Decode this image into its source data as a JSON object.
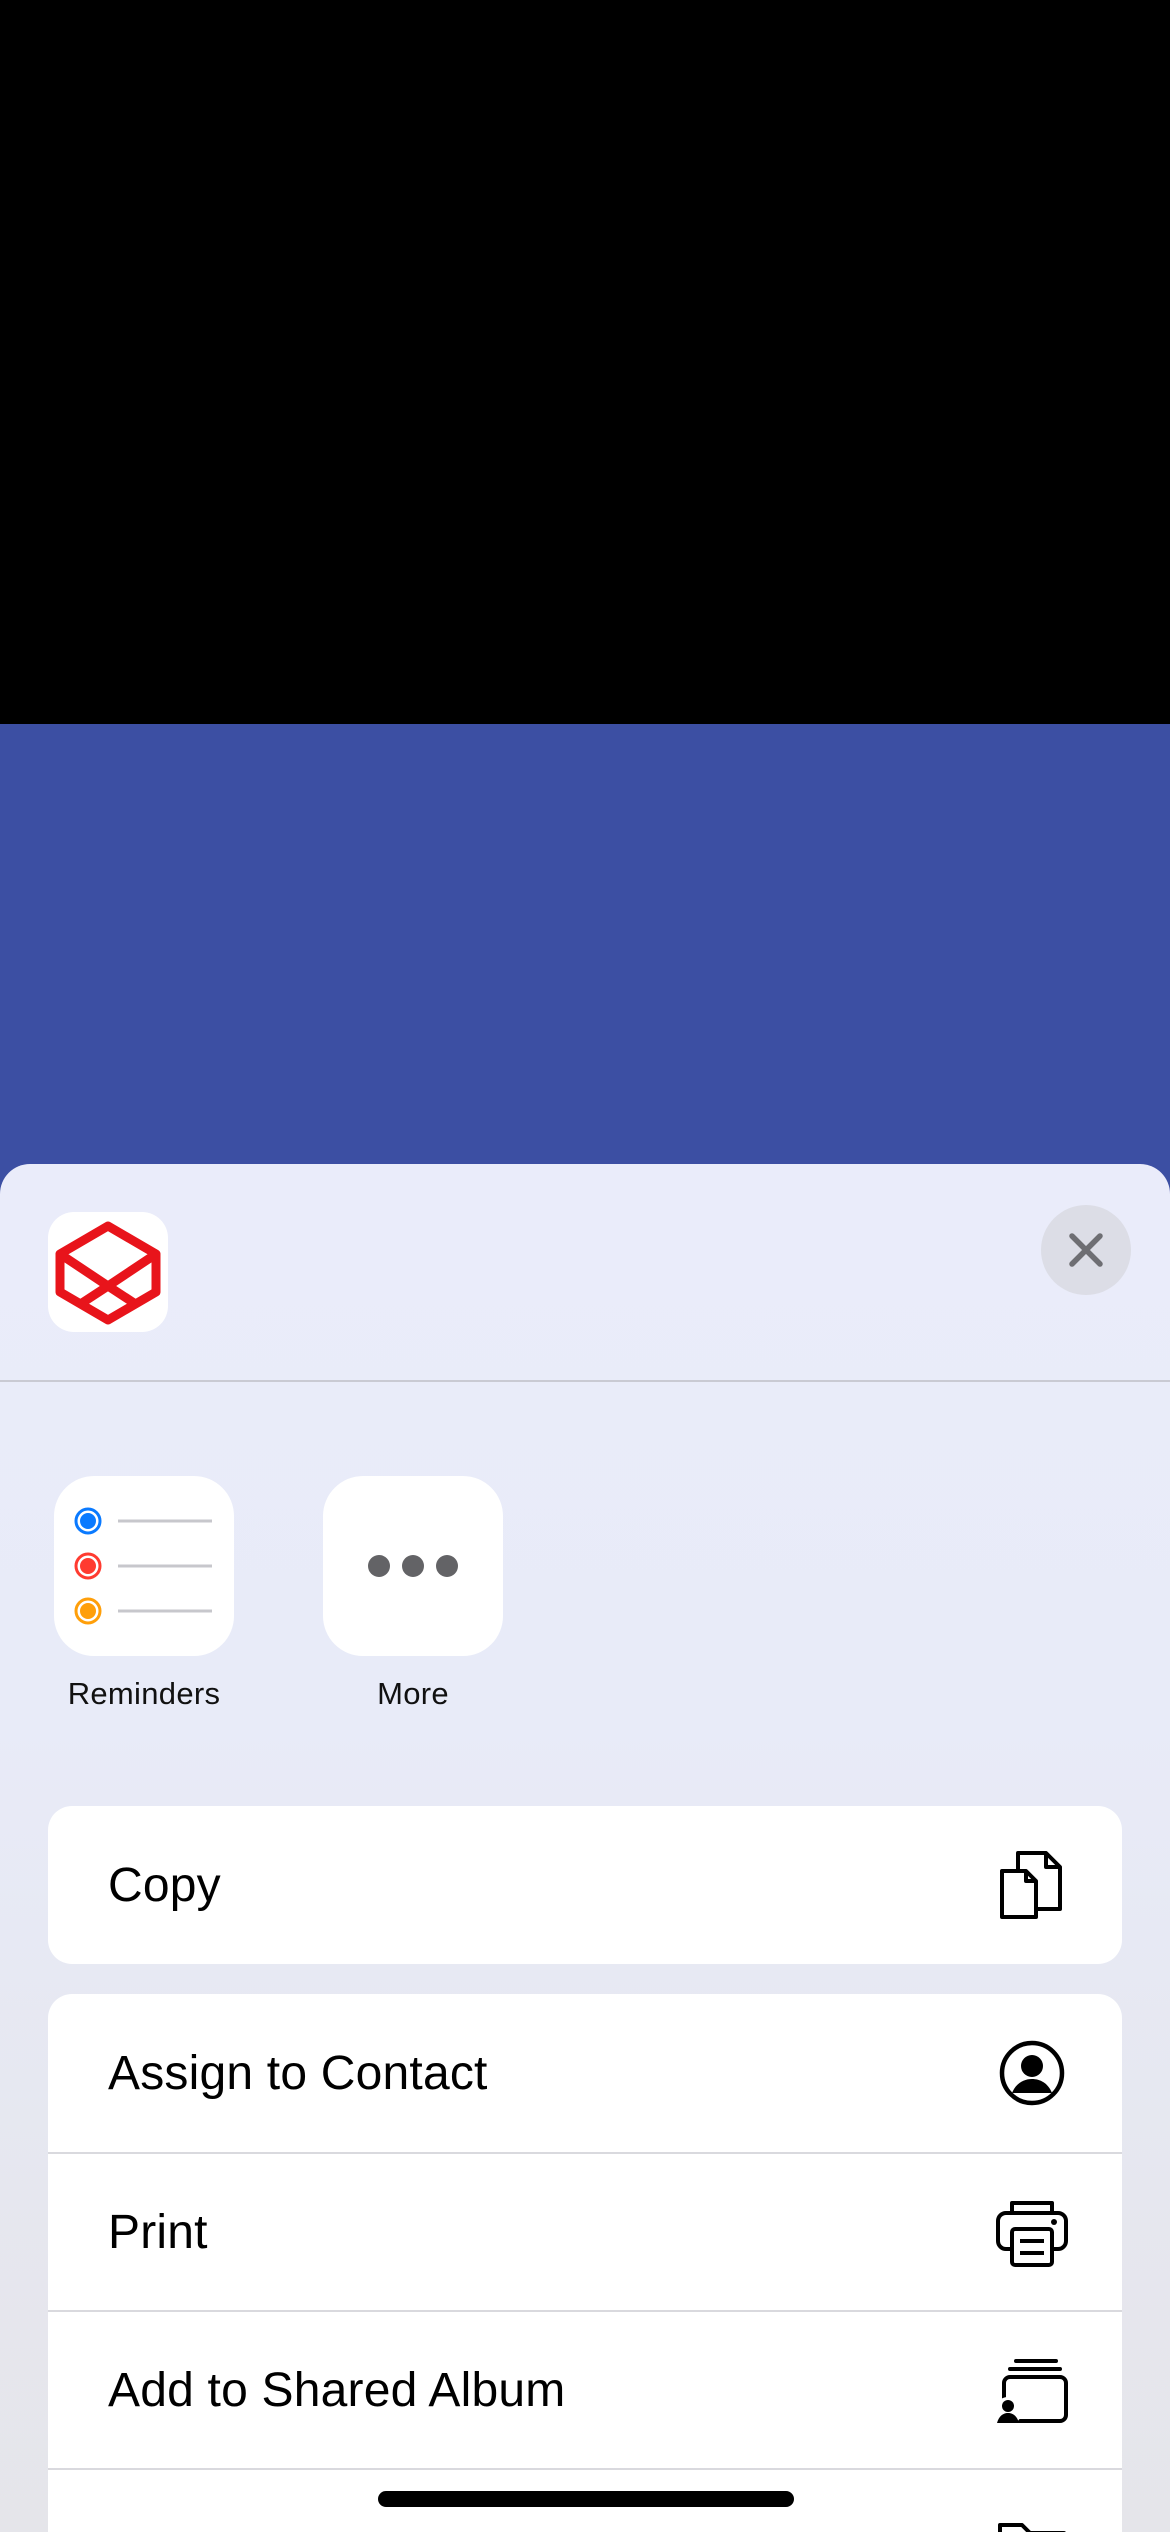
{
  "sheet": {
    "apps": [
      {
        "label": "Reminders",
        "icon": "reminders-icon"
      },
      {
        "label": "More",
        "icon": "more-icon"
      }
    ],
    "close_icon": "close-icon",
    "header_icon": "app-logo-icon"
  },
  "actions": {
    "group1": [
      {
        "label": "Copy",
        "icon": "copy-icon"
      }
    ],
    "group2": [
      {
        "label": "Assign to Contact",
        "icon": "contact-icon"
      },
      {
        "label": "Print",
        "icon": "printer-icon"
      },
      {
        "label": "Add to Shared Album",
        "icon": "shared-album-icon"
      },
      {
        "label": "",
        "icon": "folder-icon"
      }
    ]
  },
  "colors": {
    "background_band": "#3c4fa3",
    "logo_red": "#e8141b",
    "reminder_blue": "#0a7aff",
    "reminder_red": "#ff3b30",
    "reminder_orange": "#ff9f0a"
  }
}
